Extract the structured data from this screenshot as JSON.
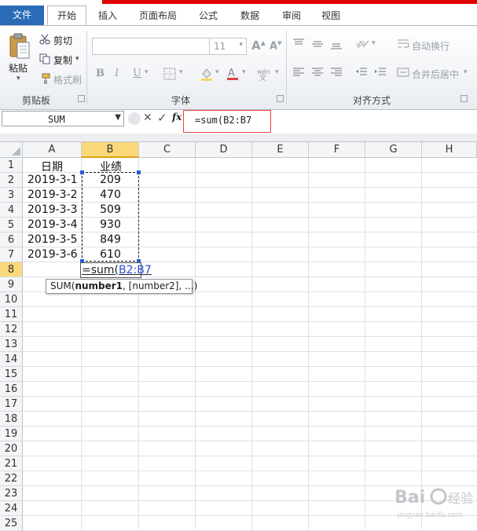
{
  "tabs": [
    {
      "label": "文件"
    },
    {
      "label": "开始"
    },
    {
      "label": "插入"
    },
    {
      "label": "页面布局"
    },
    {
      "label": "公式"
    },
    {
      "label": "数据"
    },
    {
      "label": "审阅"
    },
    {
      "label": "视图"
    }
  ],
  "ribbon": {
    "clipboard": {
      "paste": "粘贴",
      "cut": "剪切",
      "copy": "复制",
      "format_painter": "格式刷",
      "group_label": "剪贴板"
    },
    "font": {
      "size": "11",
      "bold": "B",
      "italic": "I",
      "underline": "U",
      "group_label": "字体"
    },
    "alignment": {
      "wrap_text": "自动换行",
      "merge_center": "合并后居中",
      "group_label": "对齐方式"
    }
  },
  "formula_bar": {
    "name_box": "SUM",
    "fx": "fx",
    "formula": "=sum(B2:B7"
  },
  "columns": [
    "A",
    "B",
    "C",
    "D",
    "E",
    "F",
    "G",
    "H"
  ],
  "selected_column": "B",
  "rows": [
    "1",
    "2",
    "3",
    "4",
    "5",
    "6",
    "7",
    "8",
    "9",
    "10",
    "11",
    "12",
    "13",
    "14",
    "15",
    "16",
    "17",
    "18",
    "19",
    "20",
    "21",
    "22",
    "23",
    "24",
    "25"
  ],
  "selected_row": "8",
  "cells": {
    "header_date": "日期",
    "header_perf": "业绩",
    "dates": [
      "2019-3-1",
      "2019-3-2",
      "2019-3-3",
      "2019-3-4",
      "2019-3-5",
      "2019-3-6"
    ],
    "values": [
      "209",
      "470",
      "509",
      "930",
      "849",
      "610"
    ]
  },
  "editing": {
    "prefix": "=sum(",
    "ref": "B2:B7"
  },
  "tooltip": {
    "func": "SUM(",
    "arg1": "number1",
    "rest": ", [number2], ...)"
  },
  "colors": {
    "file_tab": "#2a6bb8",
    "selection_header": "#fbd97a",
    "reference_blue": "#2a4fd0",
    "highlight_red": "#e44444"
  }
}
